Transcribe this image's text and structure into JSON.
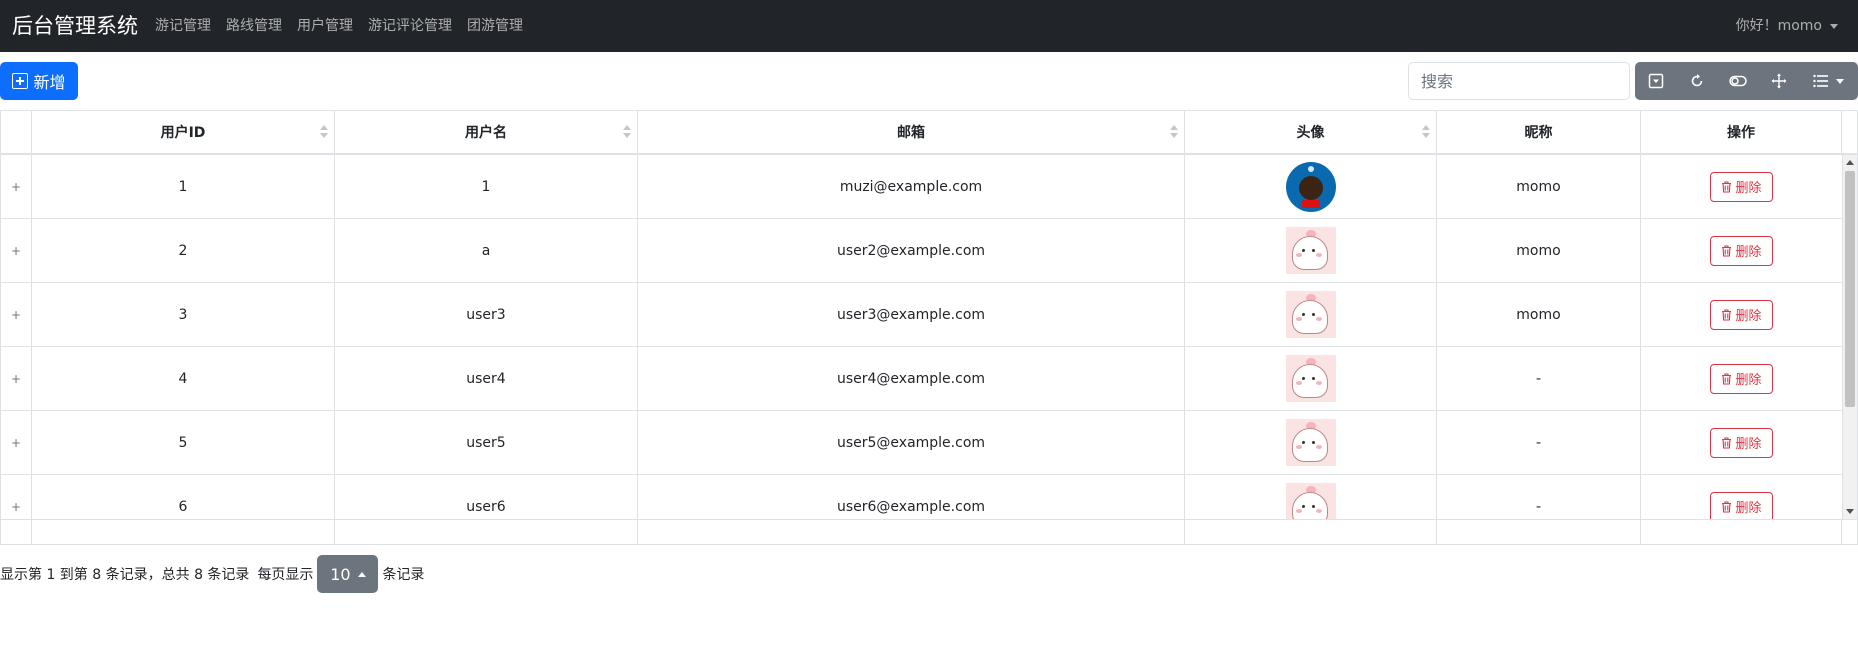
{
  "navbar": {
    "brand": "后台管理系统",
    "links": [
      "游记管理",
      "路线管理",
      "用户管理",
      "游记评论管理",
      "团游管理"
    ],
    "greeting": "你好！momo"
  },
  "toolbar": {
    "add_label": "新增",
    "search_placeholder": "搜索",
    "icons": [
      "toggle-dropdown-icon",
      "refresh-icon",
      "toggle-switch-icon",
      "fullscreen-move-icon",
      "columns-list-icon"
    ]
  },
  "table": {
    "headers": [
      "用户ID",
      "用户名",
      "邮箱",
      "头像",
      "昵称",
      "操作"
    ],
    "delete_label": "删除",
    "rows": [
      {
        "id": "1",
        "username": "1",
        "email": "muzi@example.com",
        "avatar": "blue-round-character-avatar",
        "nickname": "momo"
      },
      {
        "id": "2",
        "username": "a",
        "email": "user2@example.com",
        "avatar": "pink-cartoon-avatar",
        "nickname": "momo"
      },
      {
        "id": "3",
        "username": "user3",
        "email": "user3@example.com",
        "avatar": "pink-cartoon-avatar",
        "nickname": "momo"
      },
      {
        "id": "4",
        "username": "user4",
        "email": "user4@example.com",
        "avatar": "pink-cartoon-avatar",
        "nickname": "-"
      },
      {
        "id": "5",
        "username": "user5",
        "email": "user5@example.com",
        "avatar": "pink-cartoon-avatar",
        "nickname": "-"
      },
      {
        "id": "6",
        "username": "user6",
        "email": "user6@example.com",
        "avatar": "pink-cartoon-avatar",
        "nickname": "-"
      }
    ]
  },
  "pagination": {
    "summary": "显示第 1 到第 8 条记录，总共 8 条记录",
    "per_page_prefix": "每页显示",
    "page_size": "10",
    "per_page_suffix": "条记录"
  },
  "colors": {
    "navbar": "#212529",
    "primary": "#0d6efd",
    "secondary": "#6c757d",
    "danger": "#dc3545"
  }
}
